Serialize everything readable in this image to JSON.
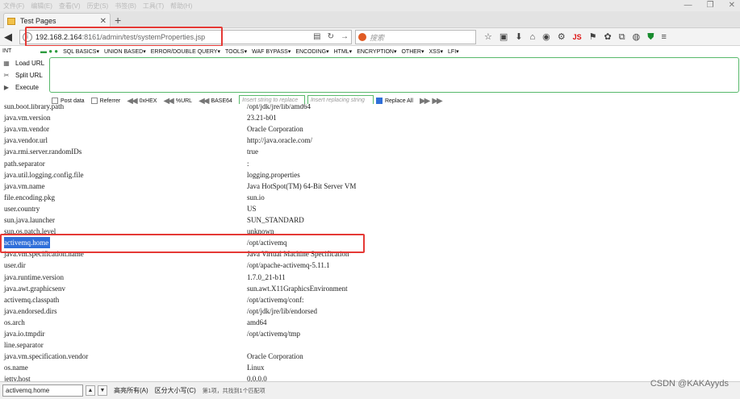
{
  "titlebar": {
    "menus": [
      "文件(F)",
      "编辑(E)",
      "查看(V)",
      "历史(S)",
      "书签(B)",
      "工具(T)",
      "帮助(H)"
    ],
    "controls": [
      "—",
      "❐",
      "✕"
    ]
  },
  "tab": {
    "title": "Test Pages",
    "close_glyph": "✕",
    "new_glyph": "+"
  },
  "nav": {
    "back_glyph": "◀",
    "url_host": "192.168.2.164",
    "url_path": ":8161/admin/test/systemProperties.jsp",
    "search_placeholder": "搜索"
  },
  "hackbar": {
    "int_select": "INT",
    "menu": [
      "SQL BASICS▾",
      "UNION BASED▾",
      "ERROR/DOUBLE QUERY▾",
      "TOOLS▾",
      "WAF BYPASS▾",
      "ENCODING▾",
      "HTML▾",
      "ENCRYPTION▾",
      "OTHER▾",
      "XSS▾",
      "LFI▾"
    ],
    "actions": [
      "Load URL",
      "Split URL",
      "Execute"
    ],
    "post_data": "Post data",
    "referrer": "Referrer",
    "hex": "0xHEX",
    "url_enc": "%URL",
    "base64": "BASE64",
    "replace_placeholder": "Insert string to replace",
    "replacing_placeholder": "Insert replacing string",
    "replace_all": "Replace All"
  },
  "properties": [
    {
      "key": "sun.boot.library.path",
      "value": "/opt/jdk/jre/lib/amd64"
    },
    {
      "key": "java.vm.version",
      "value": "23.21-b01"
    },
    {
      "key": "java.vm.vendor",
      "value": "Oracle Corporation"
    },
    {
      "key": "java.vendor.url",
      "value": "http://java.oracle.com/"
    },
    {
      "key": "java.rmi.server.randomIDs",
      "value": "true"
    },
    {
      "key": "path.separator",
      "value": ":"
    },
    {
      "key": "java.util.logging.config.file",
      "value": "logging.properties"
    },
    {
      "key": "java.vm.name",
      "value": "Java HotSpot(TM) 64-Bit Server VM"
    },
    {
      "key": "file.encoding.pkg",
      "value": "sun.io"
    },
    {
      "key": "user.country",
      "value": "US"
    },
    {
      "key": "sun.java.launcher",
      "value": "SUN_STANDARD"
    },
    {
      "key": "sun.os.patch.level",
      "value": "unknown"
    },
    {
      "key": "activemq.home",
      "value": "/opt/activemq"
    },
    {
      "key": "java.vm.specification.name",
      "value": "Java Virtual Machine Specification"
    },
    {
      "key": "user.dir",
      "value": "/opt/apache-activemq-5.11.1"
    },
    {
      "key": "java.runtime.version",
      "value": "1.7.0_21-b11"
    },
    {
      "key": "java.awt.graphicsenv",
      "value": "sun.awt.X11GraphicsEnvironment"
    },
    {
      "key": "activemq.classpath",
      "value": "/opt/activemq/conf:"
    },
    {
      "key": "java.endorsed.dirs",
      "value": "/opt/jdk/jre/lib/endorsed"
    },
    {
      "key": "os.arch",
      "value": "amd64"
    },
    {
      "key": "java.io.tmpdir",
      "value": "/opt/activemq/tmp"
    },
    {
      "key": "line.separator",
      "value": ""
    },
    {
      "key": "java.vm.specification.vendor",
      "value": "Oracle Corporation"
    },
    {
      "key": "os.name",
      "value": "Linux"
    },
    {
      "key": "jetty.host",
      "value": "0.0.0.0"
    }
  ],
  "highlighted_key": "activemq.home",
  "findbar": {
    "query": "activemq.home",
    "highlight_all": "高亮所有(A)",
    "match_case": "区分大小写(C)",
    "status": "第1项，共找到1个匹配项"
  },
  "watermark": "CSDN @KAKAyyds",
  "colors": {
    "annotation_red": "#e53935",
    "selection_blue": "#2f6fd9",
    "hackbar_green": "#57b86a"
  }
}
